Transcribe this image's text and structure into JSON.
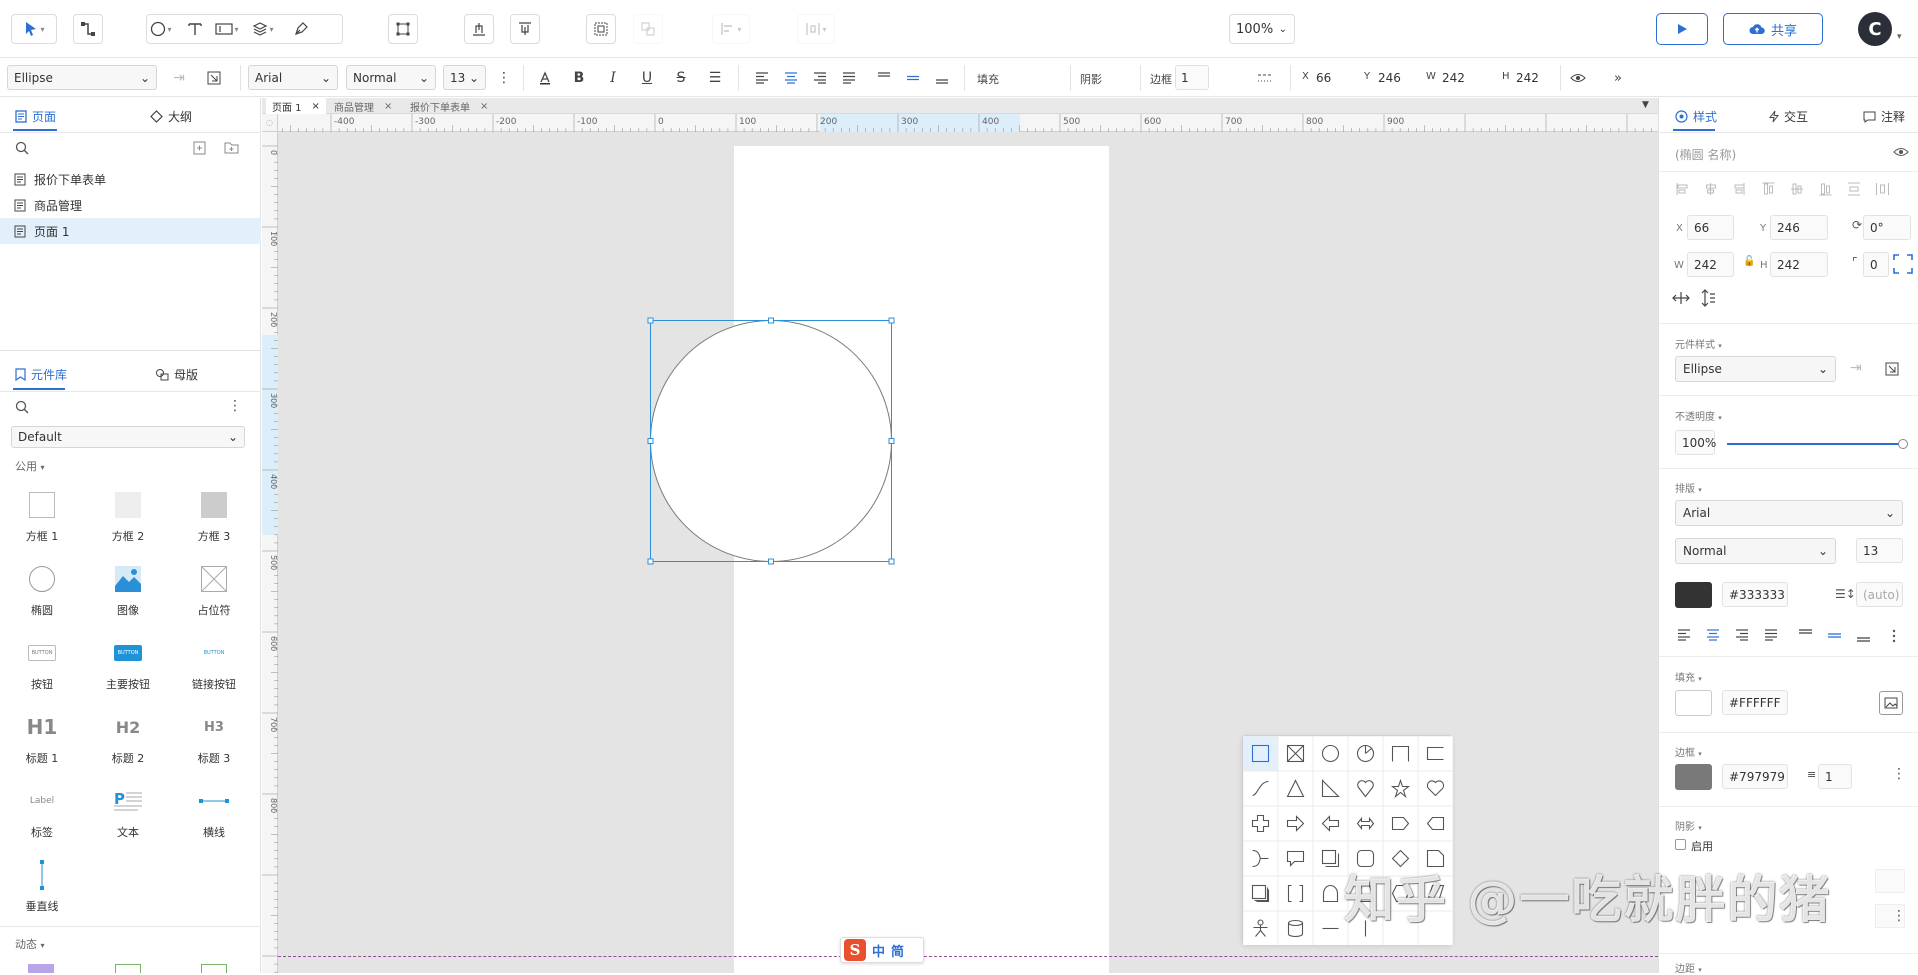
{
  "toolbar": {
    "zoom": "100%",
    "share_label": "共享",
    "avatar_letter": "C"
  },
  "propbar": {
    "style_select": "Ellipse",
    "font_family": "Arial",
    "font_weight": "Normal",
    "font_size": "13",
    "fill_label": "填充",
    "shadow_label": "阴影",
    "border_label": "边框",
    "border_width": "1",
    "x_label": "X",
    "x": "66",
    "y_label": "Y",
    "y": "246",
    "w_label": "W",
    "w": "242",
    "h_label": "H",
    "h": "242"
  },
  "left": {
    "tab_pages": "页面",
    "tab_outline": "大纲",
    "pages": [
      "报价下单表单",
      "商品管理",
      "页面 1"
    ],
    "tab_library": "元件库",
    "tab_masters": "母版",
    "library_select": "Default",
    "group_common": "公用",
    "components": [
      "方框 1",
      "方框 2",
      "方框 3",
      "椭圆",
      "图像",
      "占位符",
      "按钮",
      "主要按钮",
      "链接按钮",
      "标题 1",
      "标题 2",
      "标题 3",
      "标签",
      "文本",
      "横线",
      "垂直线"
    ],
    "thumb_button": "BUTTON",
    "thumb_h1": "H1",
    "thumb_h2": "H2",
    "thumb_h3": "H3",
    "thumb_label": "Label",
    "group_dynamic": "动态"
  },
  "canvas": {
    "doc_tabs": [
      "页面 1",
      "商品管理",
      "报价下单表单"
    ],
    "ruler_h": [
      "-400",
      "-300",
      "-200",
      "-100",
      "0",
      "100",
      "200",
      "300",
      "400",
      "500",
      "600",
      "700",
      "800",
      "900"
    ],
    "ruler_v": [
      "0",
      "100",
      "200",
      "300",
      "400",
      "500",
      "600",
      "700",
      "800"
    ]
  },
  "right": {
    "tab_style": "样式",
    "tab_interact": "交互",
    "tab_notes": "注释",
    "name_placeholder": "(椭圆 名称)",
    "x_label": "X",
    "x": "66",
    "y_label": "Y",
    "y": "246",
    "rotation": "0°",
    "w_label": "W",
    "w": "242",
    "h_label": "H",
    "h": "242",
    "radius": "0",
    "section_component_style": "元件样式",
    "component_style": "Ellipse",
    "section_opacity": "不透明度",
    "opacity": "100%",
    "opacity_value": 1.0,
    "section_typography": "排版",
    "font_family": "Arial",
    "font_weight": "Normal",
    "font_size": "13",
    "text_color_hex": "#333333",
    "line_height": "(auto)",
    "section_fill": "填充",
    "fill_hex": "#FFFFFF",
    "section_border": "边框",
    "border_hex": "#797979",
    "border_width": "1",
    "section_shadow": "阴影",
    "shadow_enable": "启用",
    "section_border2": "边距"
  },
  "ime": {
    "lang": "中",
    "mode": "简"
  },
  "watermark": "知乎 @一吃就胖的猪",
  "colors": {
    "accent": "#2d6fd3",
    "selection": "#2d8fd8",
    "text_color": "#333333",
    "border_color": "#797979",
    "page_selected": "#e1f0fb"
  }
}
